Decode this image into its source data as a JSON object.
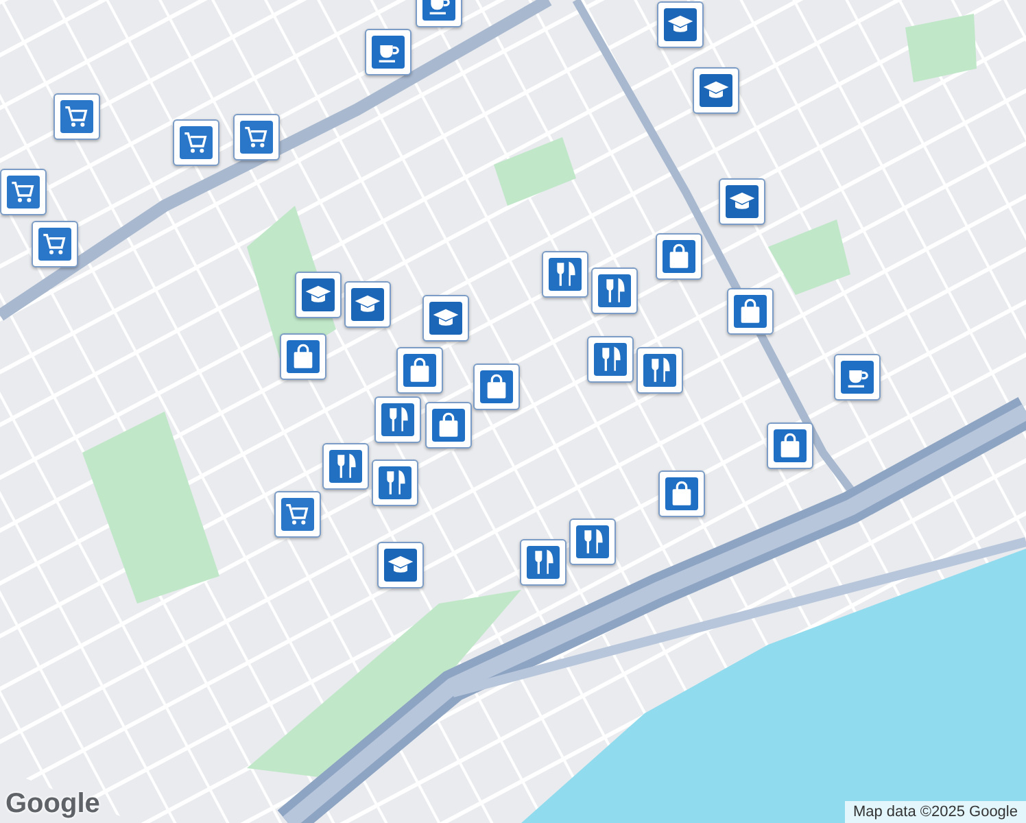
{
  "map": {
    "markers": [
      {
        "kind": "cafe"
      },
      {
        "kind": "cafe"
      },
      {
        "kind": "cart"
      },
      {
        "kind": "cart"
      },
      {
        "kind": "cart"
      },
      {
        "kind": "cart"
      },
      {
        "kind": "cart"
      },
      {
        "kind": "school"
      },
      {
        "kind": "school"
      },
      {
        "kind": "school"
      },
      {
        "kind": "bag"
      },
      {
        "kind": "restaurant"
      },
      {
        "kind": "restaurant"
      },
      {
        "kind": "bag"
      },
      {
        "kind": "school"
      },
      {
        "kind": "school"
      },
      {
        "kind": "bag"
      },
      {
        "kind": "school"
      },
      {
        "kind": "bag"
      },
      {
        "kind": "bag"
      },
      {
        "kind": "restaurant"
      },
      {
        "kind": "bag"
      },
      {
        "kind": "restaurant"
      },
      {
        "kind": "restaurant"
      },
      {
        "kind": "cafe"
      },
      {
        "kind": "bag"
      },
      {
        "kind": "bag"
      },
      {
        "kind": "restaurant"
      },
      {
        "kind": "restaurant"
      },
      {
        "kind": "cart"
      },
      {
        "kind": "restaurant"
      },
      {
        "kind": "restaurant"
      },
      {
        "kind": "school"
      }
    ]
  },
  "attribution": "Map data ©2025 Google",
  "logo": "Google"
}
